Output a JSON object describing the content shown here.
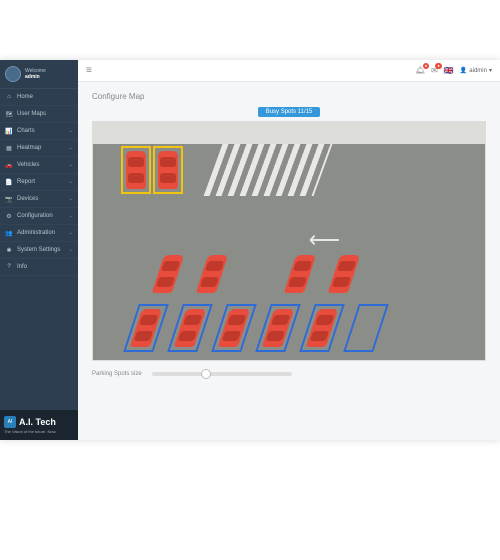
{
  "sidebar": {
    "welcome_label": "Welcome",
    "username": "admin",
    "items": [
      {
        "icon": "⌂",
        "label": "Home",
        "expandable": false
      },
      {
        "icon": "🗺",
        "label": "User Maps",
        "expandable": false
      },
      {
        "icon": "📊",
        "label": "Charts",
        "expandable": true
      },
      {
        "icon": "▦",
        "label": "Heatmap",
        "expandable": true
      },
      {
        "icon": "🚗",
        "label": "Vehicles",
        "expandable": true
      },
      {
        "icon": "📄",
        "label": "Report",
        "expandable": true
      },
      {
        "icon": "📷",
        "label": "Devices",
        "expandable": true
      },
      {
        "icon": "⚙",
        "label": "Configuration",
        "expandable": true
      },
      {
        "icon": "👥",
        "label": "Administration",
        "expandable": true
      },
      {
        "icon": "✱",
        "label": "System Settings",
        "expandable": true
      },
      {
        "icon": "?",
        "label": "Info",
        "expandable": false
      }
    ]
  },
  "brand": {
    "name": "A.I. Tech",
    "tagline": "The Vision of the future. Now.",
    "logo_text": "AI"
  },
  "topbar": {
    "notif1_badge": "",
    "notif2_badge": "",
    "flag": "🇬🇧",
    "user": "aidmin",
    "caret": "▾"
  },
  "page": {
    "title": "Configure Map",
    "busy_label": "Busy Spots 11/15",
    "slider_label": "Parking Spots size"
  },
  "parking": {
    "total_spots": 15,
    "busy_spots": 11,
    "top_row": [
      {
        "occupied": true,
        "highlight": "yellow"
      },
      {
        "occupied": true,
        "highlight": "yellow"
      }
    ],
    "mid_row": [
      {
        "occupied": true
      },
      {
        "occupied": true
      },
      {
        "occupied": false
      },
      {
        "occupied": true
      },
      {
        "occupied": true
      }
    ],
    "bottom_row": [
      {
        "occupied": true,
        "highlight": "blue"
      },
      {
        "occupied": true,
        "highlight": "blue"
      },
      {
        "occupied": true,
        "highlight": "blue"
      },
      {
        "occupied": true,
        "highlight": "blue"
      },
      {
        "occupied": true,
        "highlight": "blue"
      },
      {
        "occupied": false,
        "highlight": "blue"
      }
    ]
  },
  "colors": {
    "occupied": "#e74c3c",
    "highlight_yellow": "#f1c40f",
    "highlight_blue": "#2e6bd6",
    "sidebar": "#2c3e50",
    "pill": "#3498db"
  }
}
